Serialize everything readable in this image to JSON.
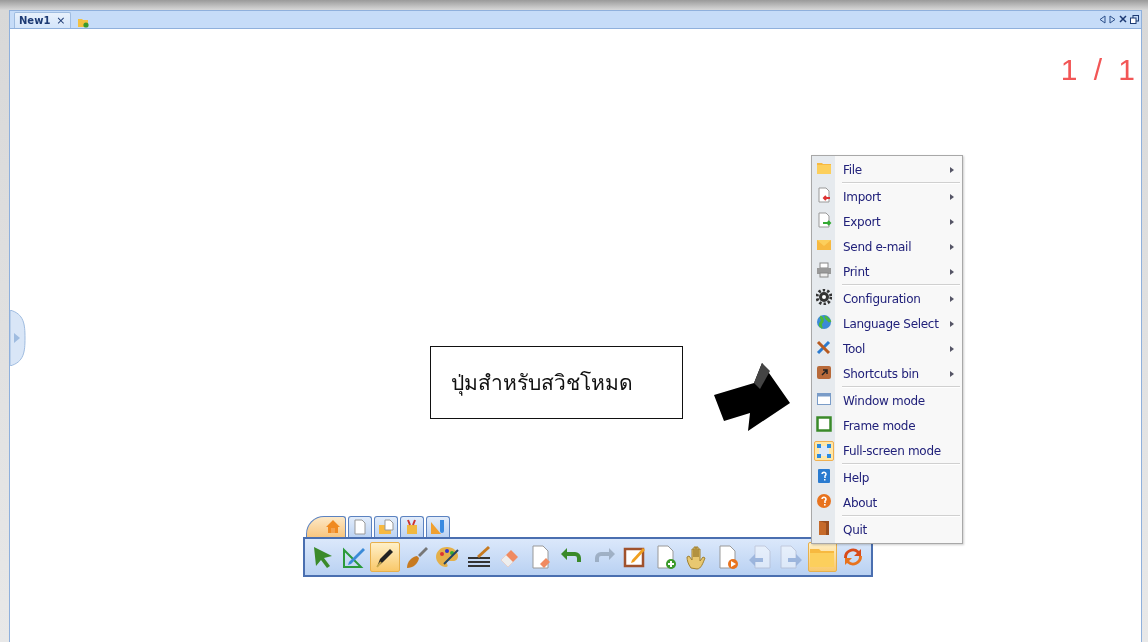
{
  "tabs": [
    {
      "label": "New1",
      "close": "×",
      "selected": true
    }
  ],
  "page_number": "1 / 1",
  "callout": "ปุ่มสำหรับสวิชโหมด",
  "menu": [
    {
      "label": "File",
      "submenu": true,
      "separator_after": true,
      "highlighted": false
    },
    {
      "label": "Import",
      "submenu": true,
      "separator_after": false,
      "highlighted": false
    },
    {
      "label": "Export",
      "submenu": true,
      "separator_after": false,
      "highlighted": false
    },
    {
      "label": "Send e-mail",
      "submenu": true,
      "separator_after": false,
      "highlighted": false
    },
    {
      "label": "Print",
      "submenu": true,
      "separator_after": true,
      "highlighted": false
    },
    {
      "label": "Configuration",
      "submenu": true,
      "separator_after": false,
      "highlighted": false
    },
    {
      "label": "Language Select",
      "submenu": true,
      "separator_after": false,
      "highlighted": false
    },
    {
      "label": "Tool",
      "submenu": true,
      "separator_after": false,
      "highlighted": false
    },
    {
      "label": "Shortcuts bin",
      "submenu": true,
      "separator_after": true,
      "highlighted": false
    },
    {
      "label": "Window mode",
      "submenu": false,
      "separator_after": false,
      "highlighted": false
    },
    {
      "label": "Frame mode",
      "submenu": false,
      "separator_after": false,
      "highlighted": false
    },
    {
      "label": "Full-screen mode",
      "submenu": false,
      "separator_after": true,
      "highlighted": true
    },
    {
      "label": "Help",
      "submenu": false,
      "separator_after": false,
      "highlighted": false
    },
    {
      "label": "About",
      "submenu": false,
      "separator_after": true,
      "highlighted": false
    },
    {
      "label": "Quit",
      "submenu": false,
      "separator_after": false,
      "highlighted": false
    }
  ],
  "toolbar": {
    "tabs": [
      {
        "selected": true
      },
      {
        "selected": false
      },
      {
        "selected": false
      },
      {
        "selected": false
      },
      {
        "selected": false
      }
    ],
    "buttons": [
      {
        "selected": false,
        "disabled": false
      },
      {
        "selected": false,
        "disabled": false
      },
      {
        "selected": true,
        "disabled": false
      },
      {
        "selected": false,
        "disabled": false
      },
      {
        "selected": false,
        "disabled": false
      },
      {
        "selected": false,
        "disabled": false
      },
      {
        "selected": false,
        "disabled": false
      },
      {
        "selected": false,
        "disabled": false
      },
      {
        "selected": false,
        "disabled": false
      },
      {
        "selected": false,
        "disabled": true
      },
      {
        "selected": false,
        "disabled": false
      },
      {
        "selected": false,
        "disabled": false
      },
      {
        "selected": false,
        "disabled": false
      },
      {
        "selected": false,
        "disabled": false
      },
      {
        "selected": false,
        "disabled": true
      },
      {
        "selected": false,
        "disabled": true
      },
      {
        "selected": true,
        "disabled": false
      },
      {
        "selected": false,
        "disabled": false
      }
    ]
  }
}
